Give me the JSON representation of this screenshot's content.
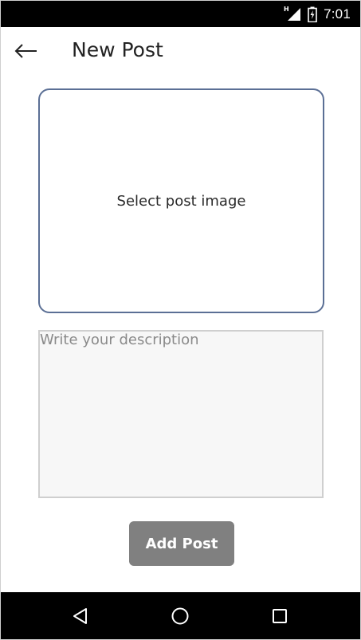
{
  "status_bar": {
    "network_label": "H",
    "time": "7:01"
  },
  "app_bar": {
    "title": "New Post",
    "back_icon": "arrow-left-icon"
  },
  "image_picker": {
    "label": "Select post image"
  },
  "description": {
    "placeholder": "Write your description",
    "value": ""
  },
  "actions": {
    "add_post_label": "Add Post"
  },
  "nav_bar": {
    "icons": [
      "back-triangle-icon",
      "home-circle-icon",
      "recents-square-icon"
    ]
  },
  "colors": {
    "picker_border": "#5b6f95",
    "button_bg": "#808080",
    "input_bg": "#f7f7f7"
  }
}
